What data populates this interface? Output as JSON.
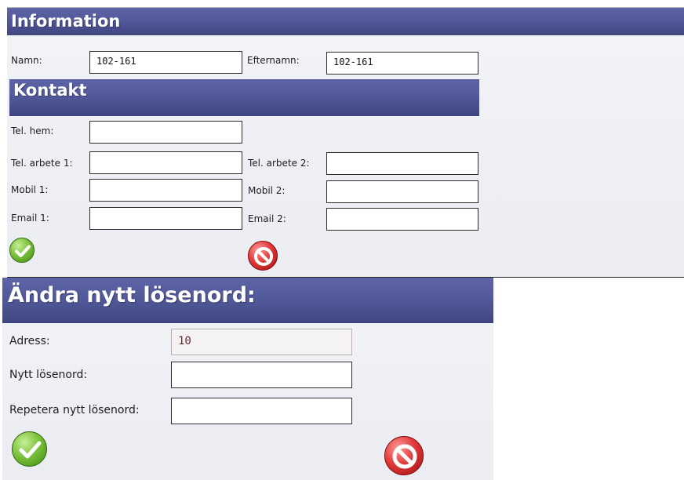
{
  "contact_form": {
    "info_header": "Information",
    "namn_label": "Namn:",
    "namn_value": "102-161",
    "efternamn_label": "Efternamn:",
    "efternamn_value": "102-161",
    "kontakt_header": "Kontakt",
    "tel_hem_label": "Tel. hem:",
    "tel_arbete1_label": "Tel. arbete 1:",
    "tel_arbete2_label": "Tel. arbete 2:",
    "mobil1_label": "Mobil 1:",
    "mobil2_label": "Mobil 2:",
    "email1_label": "Email 1:",
    "email2_label": "Email 2:",
    "ok_icon": "checkmark-icon",
    "cancel_icon": "cancel-icon"
  },
  "password_form": {
    "header": "Ändra nytt lösenord:",
    "adress_label": "Adress:",
    "adress_value": "10",
    "nytt_label": "Nytt lösenord:",
    "repetera_label": "Repetera nytt lösenord:",
    "ok_icon": "checkmark-icon",
    "cancel_icon": "cancel-icon"
  },
  "colors": {
    "header_start": "#5d64a6",
    "header_end": "#3f467f",
    "panel_bg": "#f3f4f8",
    "ok_green": "#6fb336",
    "cancel_red": "#d42a2a"
  }
}
